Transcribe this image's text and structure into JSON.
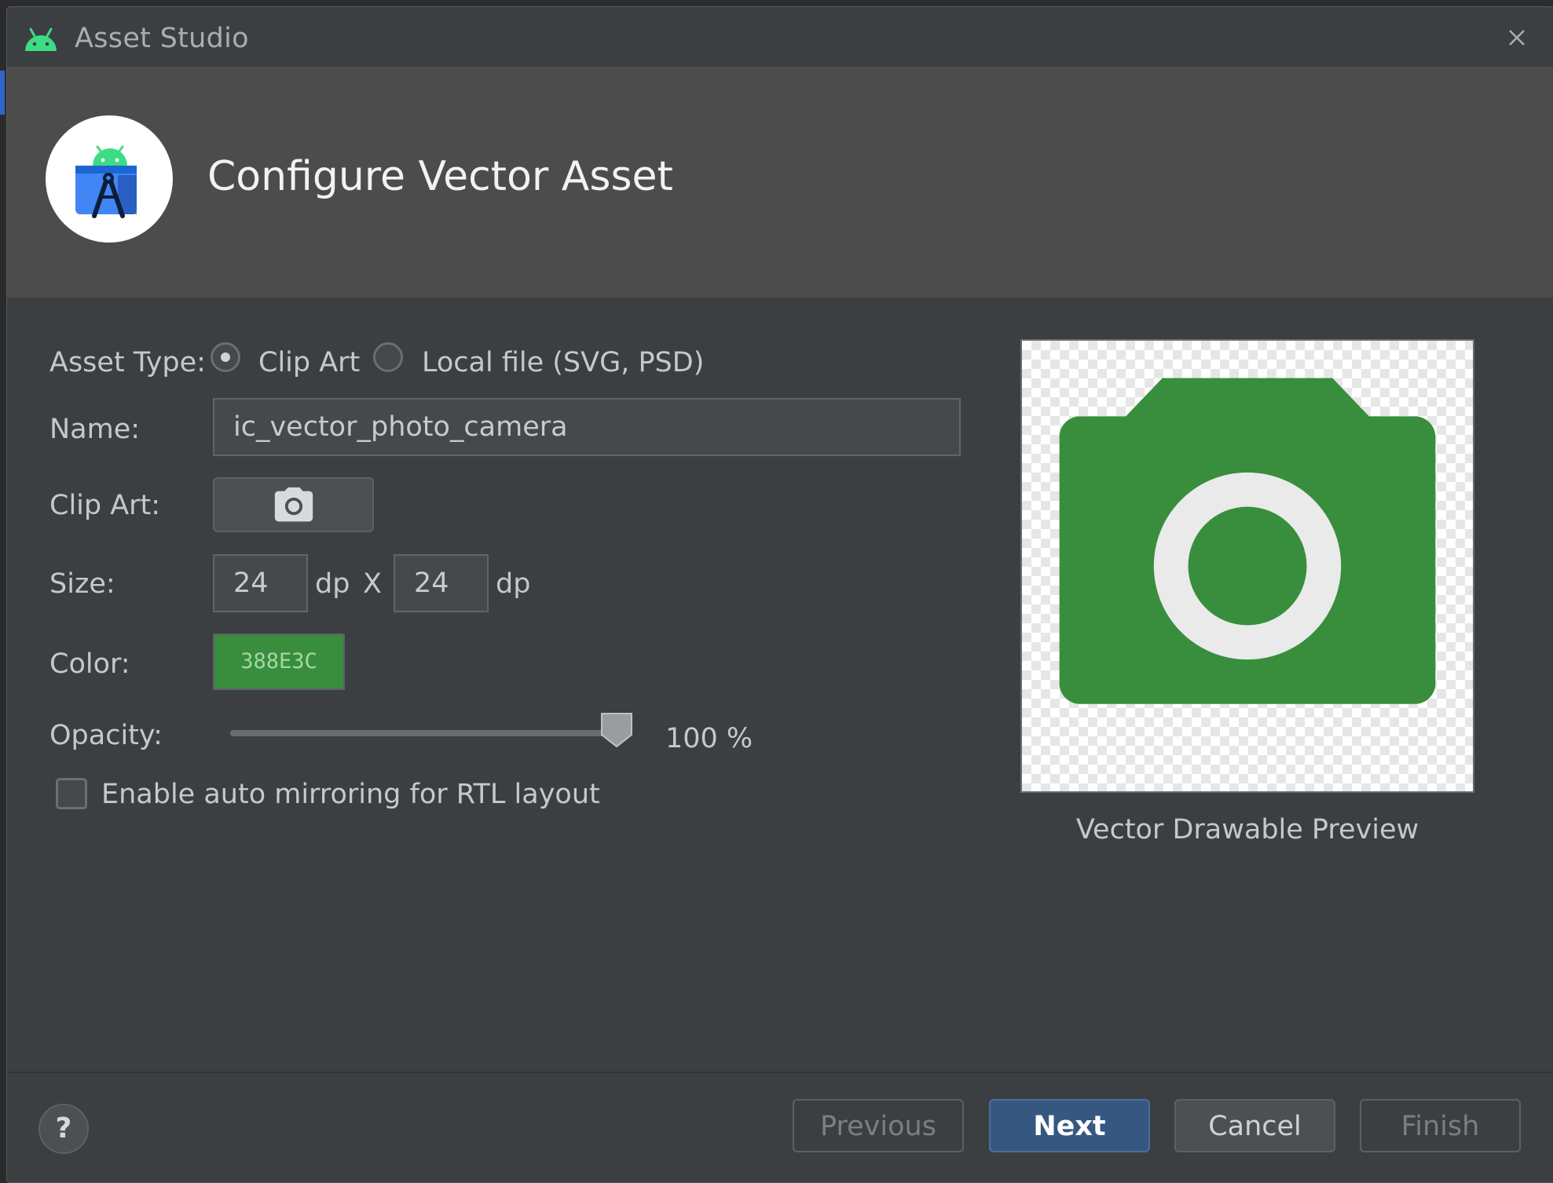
{
  "window": {
    "title": "Asset Studio",
    "close_icon": "close-icon",
    "app_icon": "android-icon"
  },
  "header": {
    "title": "Configure Vector Asset",
    "logo_icon": "android-studio-logo-icon"
  },
  "form": {
    "asset_type": {
      "label": "Asset Type:",
      "options": [
        {
          "label": "Clip Art",
          "selected": true
        },
        {
          "label": "Local file (SVG, PSD)",
          "selected": false
        }
      ]
    },
    "name": {
      "label": "Name:",
      "value": "ic_vector_photo_camera"
    },
    "clip_art": {
      "label": "Clip Art:",
      "icon": "camera-icon"
    },
    "size": {
      "label": "Size:",
      "width": "24",
      "height": "24",
      "unit": "dp",
      "separator": "X"
    },
    "color": {
      "label": "Color:",
      "value": "388E3C",
      "hex": "#388E3C"
    },
    "opacity": {
      "label": "Opacity:",
      "value_text": "100 %",
      "fraction": 1.0
    },
    "auto_mirroring": {
      "label": "Enable auto mirroring for RTL layout",
      "checked": false
    }
  },
  "preview": {
    "caption": "Vector Drawable Preview",
    "icon": "camera-icon",
    "icon_color": "#388E3C"
  },
  "footer": {
    "help_label": "?",
    "previous_label": "Previous",
    "next_label": "Next",
    "cancel_label": "Cancel",
    "finish_label": "Finish"
  }
}
